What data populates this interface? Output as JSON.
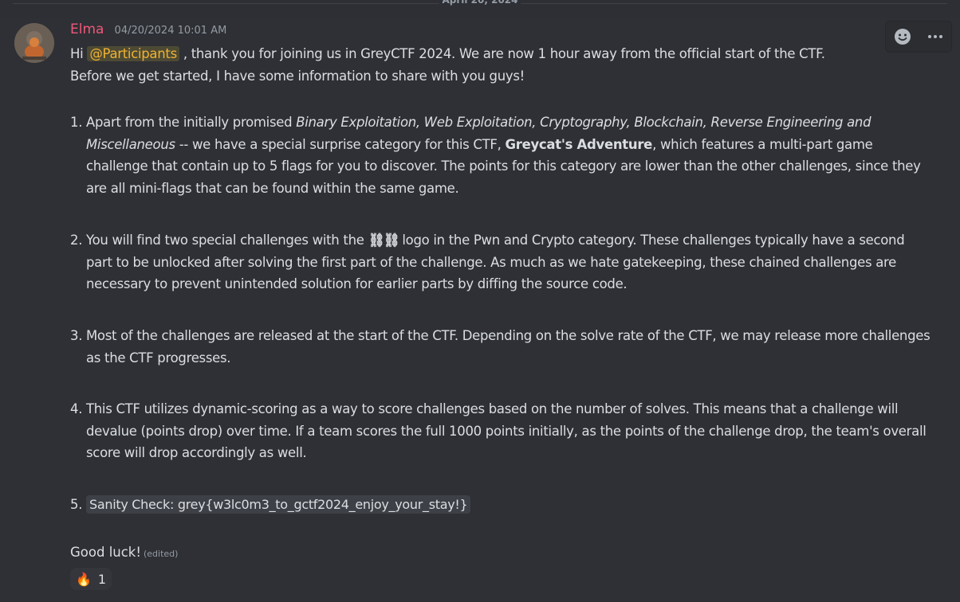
{
  "divider": {
    "date": "April 20, 2024"
  },
  "message": {
    "author": "Elma",
    "timestamp": "04/20/2024 10:01 AM",
    "intro": {
      "pre": "Hi ",
      "mention": "@Participants",
      "post": " , thank you for joining us in GreyCTF 2024. We are now 1 hour away from the official start of the CTF.",
      "line2": "Before we get started, I have some information to share with you guys!"
    },
    "items": [
      {
        "num": "1.",
        "part1": "Apart from the initially promised ",
        "italic": "Binary Exploitation, Web Exploitation, Cryptography, Blockchain, Reverse Engineering and Miscellaneous",
        "part2": " -- we have a special surprise category for this CTF, ",
        "bold": "Greycat's Adventure",
        "part3": ", which features a multi-part game challenge that contain up to 5 flags for you to discover. The points for this category are lower than the other challenges, since they are all mini-flags that can be found within the same game."
      },
      {
        "num": "2.",
        "part1": "You will find two special challenges with the ",
        "emoji": "⛓⛓",
        "part2": " logo in the Pwn and Crypto category. These challenges typically have a second part to be unlocked after solving the first part of the challenge. As much as we hate gatekeeping, these chained challenges are necessary to prevent unintended solution for earlier parts by diffing the source code."
      },
      {
        "num": "3.",
        "text": "Most of the challenges are released at the start of the CTF. Depending on the solve rate of the CTF, we may release more challenges as the CTF progresses."
      },
      {
        "num": "4.",
        "text": "This CTF utilizes dynamic-scoring as a way to score challenges based on the number of solves. This means that a challenge will devalue (points drop) over time. If a team scores the full 1000 points initially, as the points of the challenge drop, the team's overall score will drop accordingly as well."
      },
      {
        "num": "5.",
        "code": "Sanity Check: grey{w3lc0m3_to_gctf2024_enjoy_your_stay!}"
      }
    ],
    "closing": "Good luck!",
    "edited": "(edited)",
    "reaction": {
      "emoji": "🔥",
      "count": "1"
    }
  },
  "toolbar": {
    "icons": [
      "add-reaction-icon",
      "more-options-icon"
    ]
  },
  "colors": {
    "author": "#f0587a",
    "mention_text": "#f0b232",
    "background": "#2e3035"
  }
}
